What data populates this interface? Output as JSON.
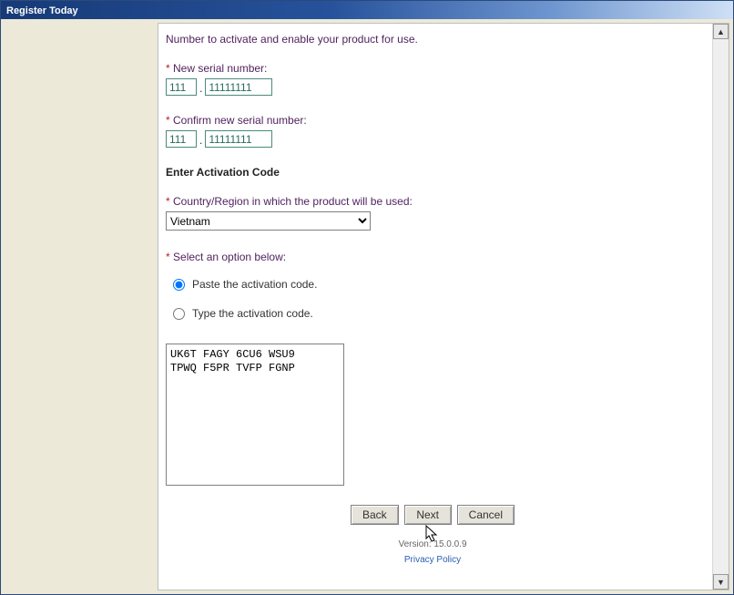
{
  "window": {
    "title": "Register Today"
  },
  "intro_tail": "Number to activate and enable your product for use.",
  "serial": {
    "new_label": "New serial number:",
    "confirm_label": "Confirm new serial number:",
    "part1": "111",
    "part2": "11111111",
    "confirm_part1": "111",
    "confirm_part2": "11111111",
    "dash": "."
  },
  "activation": {
    "heading": "Enter Activation Code",
    "country_label": "Country/Region in which the product will be used:",
    "country_value": "Vietnam",
    "select_option_label": "Select an option below:",
    "radio_paste": "Paste the activation code.",
    "radio_type": "Type the activation code.",
    "code_text": "UK6T FAGY 6CU6 WSU9\nTPWQ F5PR TVFP FGNP"
  },
  "buttons": {
    "back": "Back",
    "next": "Next",
    "cancel": "Cancel"
  },
  "footer": {
    "version": "Version: 15.0.0.9",
    "privacy": "Privacy Policy"
  },
  "asterisk": "* "
}
